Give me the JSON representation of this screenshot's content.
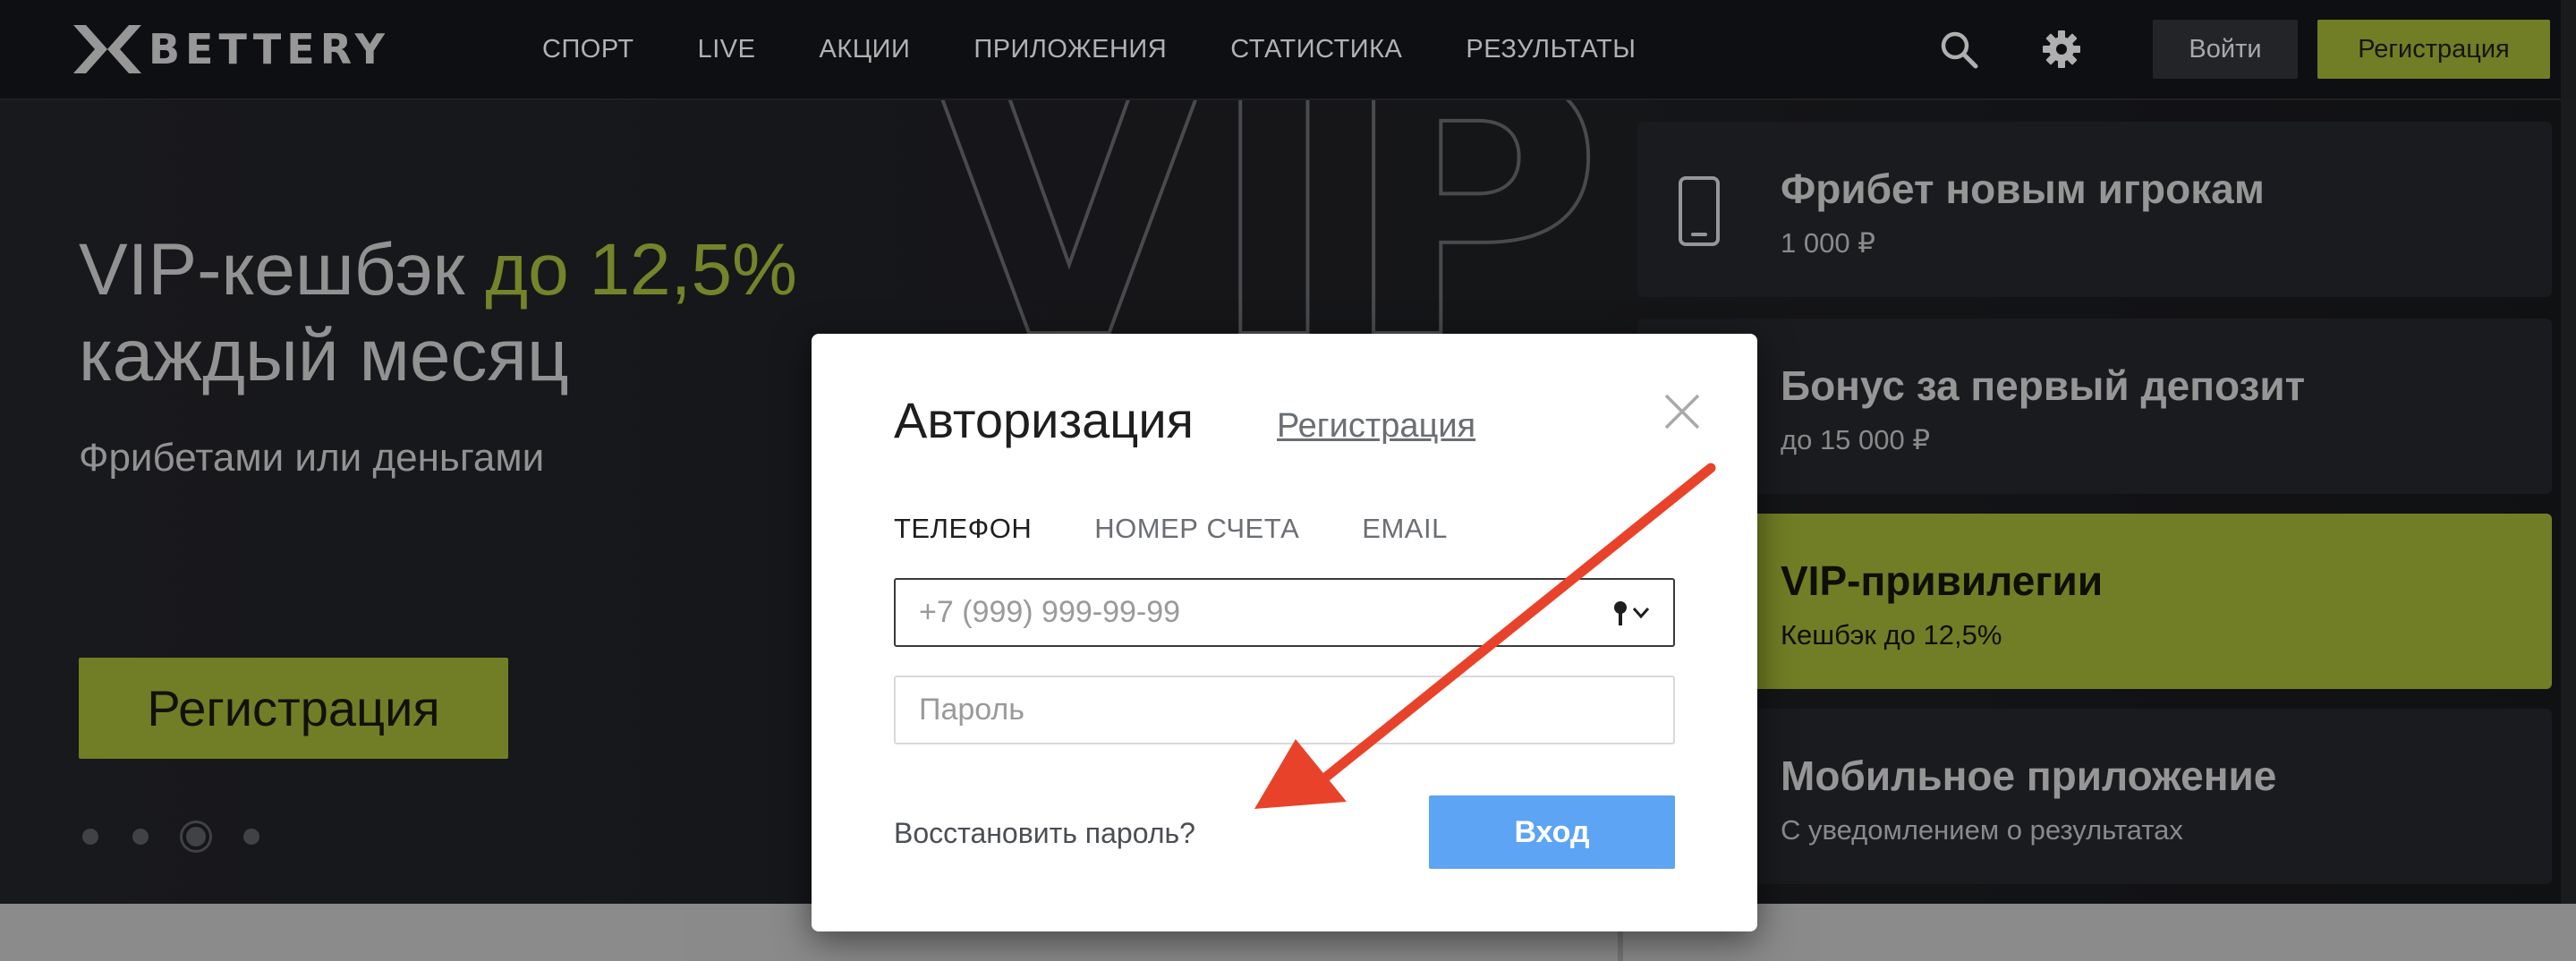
{
  "header": {
    "logo_text": "BETTERY",
    "nav": [
      "СПОРТ",
      "LIVE",
      "АКЦИИ",
      "ПРИЛОЖЕНИЯ",
      "СТАТИСТИКА",
      "РЕЗУЛЬТАТЫ"
    ],
    "icons": [
      "search-icon",
      "gear-icon"
    ],
    "login_label": "Войти",
    "register_label": "Регистрация"
  },
  "hero": {
    "title_line1_part1": "VIP-кешбэк",
    "title_line1_accent": "до 12,5%",
    "title_line2": "каждый месяц",
    "subtitle": "Фрибетами или деньгами",
    "button_label": "Регистрация",
    "background_text": "VIP",
    "slides_count": 4,
    "active_slide": 3
  },
  "promos": [
    {
      "title": "Фрибет новым игрокам",
      "sub": "1 000 ₽",
      "icon": "phone-icon",
      "active": false
    },
    {
      "title": "Бонус за первый депозит",
      "sub": "до 15 000 ₽",
      "active": false
    },
    {
      "title": "VIP-привилегии",
      "sub": "Кешбэк до 12,5%",
      "active": true
    },
    {
      "title": "Мобильное приложение",
      "sub": "С уведомлением о результатах",
      "active": false
    }
  ],
  "modal": {
    "title": "Авторизация",
    "register_link": "Регистрация",
    "tabs": [
      "ТЕЛЕФОН",
      "НОМЕР СЧЕТА",
      "EMAIL"
    ],
    "active_tab": 0,
    "phone_placeholder": "+7 (999) 999-99-99",
    "password_placeholder": "Пароль",
    "restore_label": "Восстановить пароль?",
    "login_button": "Вход"
  },
  "colors": {
    "accent_green": "#8a9a2e",
    "login_blue": "#5da4f4",
    "annotation_arrow": "#e8432a"
  }
}
